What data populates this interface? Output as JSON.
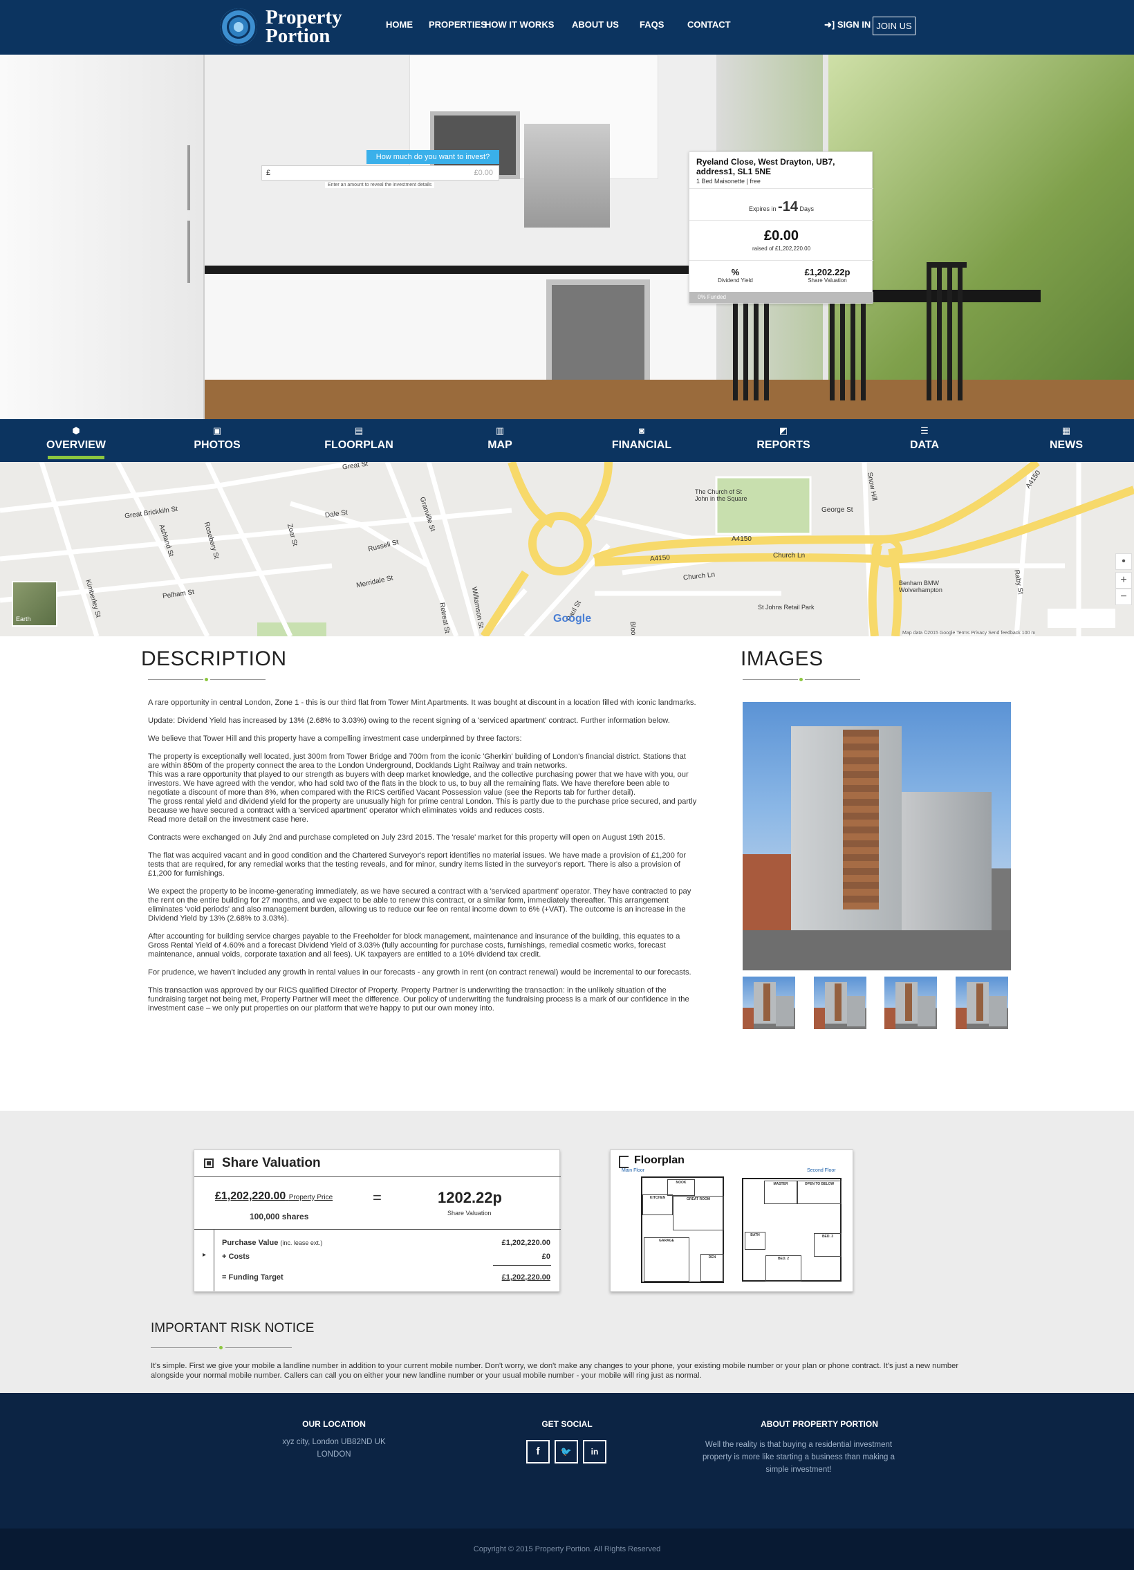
{
  "header": {
    "logo_line1": "Property",
    "logo_line2": "Portion",
    "nav": [
      "HOME",
      "PROPERTIES",
      "HOW IT WORKS",
      "ABOUT US",
      "FAQS",
      "CONTACT"
    ],
    "signin": "SIGN IN",
    "join": "JOIN US"
  },
  "hero": {
    "invest_prompt": "How much do you want to invest?",
    "currency_symbol": "£",
    "invest_placeholder": "£0.00",
    "invest_hint": "Enter an amount to reveal the investment details",
    "card": {
      "title": "Ryeland Close, West Drayton, UB7, address1, SL1 5NE",
      "subtitle": "1 Bed Maisonette | free",
      "expires_prefix": "Expires in",
      "expires_days": "-14",
      "expires_suffix": "Days",
      "amount": "£0.00",
      "raised": "raised of £1,202,220.00",
      "dividend_value": "%",
      "dividend_label": "Dividend Yield",
      "share_value": "£1,202.22p",
      "share_label": "Share Valuation",
      "funded": "0% Funded",
      "funded_fraction": 0
    }
  },
  "tabs": [
    {
      "label": "OVERVIEW",
      "icon": "cube-icon",
      "glyph": "⬢"
    },
    {
      "label": "PHOTOS",
      "icon": "photos-icon",
      "glyph": "▣"
    },
    {
      "label": "FLOORPLAN",
      "icon": "floorplan-icon",
      "glyph": "▤"
    },
    {
      "label": "MAP",
      "icon": "map-icon",
      "glyph": "▥"
    },
    {
      "label": "FINANCIAL",
      "icon": "money-icon",
      "glyph": "◙"
    },
    {
      "label": "REPORTS",
      "icon": "reports-icon",
      "glyph": "◩"
    },
    {
      "label": "DATA",
      "icon": "database-icon",
      "glyph": "☰"
    },
    {
      "label": "NEWS",
      "icon": "news-icon",
      "glyph": "▦"
    }
  ],
  "active_tab": "OVERVIEW",
  "map": {
    "labels": [
      "Great Brickkiln St",
      "Dale St",
      "Russell St",
      "Merridale St",
      "Pelham St",
      "Ashland St",
      "Rosebery St",
      "Zoar St",
      "Granville St",
      "Williamson St",
      "Retreat St",
      "Paul St",
      "Bloo",
      "Great St",
      "The Church of St John in the Square",
      "George St",
      "A4150",
      "A4150",
      "Church Ln",
      "Church Ln",
      "Snow Hill",
      "Benham BMW Wolverhampton",
      "St Johns Retail Park",
      "Raby St",
      "Kimberley St",
      "A4150"
    ],
    "earth": "Earth",
    "google": "Google",
    "attribution": "Map data ©2015 Google   Terms   Privacy   Send feedback   100 m"
  },
  "description": {
    "title": "DESCRIPTION",
    "paragraphs": [
      "A rare opportunity in central London, Zone 1 - this is our third flat from Tower Mint Apartments. It was bought at discount in a location filled with iconic landmarks.",
      "Update: Dividend Yield has increased by 13% (2.68% to 3.03%) owing to the recent signing of a 'serviced apartment' contract. Further information below.",
      "We believe that Tower Hill and this property have a compelling investment case underpinned by three factors:",
      "The property is exceptionally well located, just 300m from Tower Bridge and 700m from the iconic 'Gherkin' building of London's financial district. Stations that are within 850m of the property connect the area to the London Underground, Docklands Light Railway and train networks.\nThis was a rare opportunity that played to our strength as buyers with deep market knowledge, and the collective purchasing power that we have with you, our investors. We have agreed with the vendor, who had sold two of the flats in the block to us, to buy all the remaining flats. We have therefore been able to negotiate a discount of more than 8%, when compared with the RICS certified Vacant Possession value (see the Reports tab for further detail).\nThe gross rental yield and dividend yield for the property are unusually high for prime central London. This is partly due to the purchase price secured, and partly because we have secured a contract with a 'serviced apartment' operator which eliminates voids and reduces costs.\nRead more detail on the investment case here.",
      "Contracts were exchanged on July 2nd and purchase completed on July 23rd 2015. The 'resale' market for this property will open on August 19th 2015.",
      "The flat was acquired vacant and in good condition and the Chartered Surveyor's report identifies no material issues. We have made a provision of £1,200 for tests that are required, for any remedial works that the testing reveals, and for minor, sundry items listed in the surveyor's report. There is also a provision of £1,200 for furnishings.",
      "We expect the property to be income-generating immediately, as we have secured a contract with a 'serviced apartment' operator. They have contracted to pay the rent on the entire building for 27 months, and we expect to be able to renew this contract, or a similar form, immediately thereafter. This arrangement eliminates 'void periods' and also management burden, allowing us to reduce our fee on rental income down to 6% (+VAT).  The outcome is an increase in the Dividend Yield by 13% (2.68% to 3.03%).",
      "After accounting for building service charges payable to the Freeholder for block management, maintenance and insurance of the building, this equates to a Gross Rental Yield of 4.60% and a forecast Dividend Yield of 3.03% (fully accounting for purchase costs, furnishings, remedial cosmetic works, forecast maintenance, annual voids, corporate taxation and all fees). UK taxpayers are entitled to a 10% dividend tax credit.",
      "For prudence, we haven't included any growth in rental values in our forecasts - any growth in rent (on contract renewal) would be incremental to our forecasts.",
      "This transaction was approved by our RICS qualified Director of Property. Property Partner is underwriting the transaction: in the unlikely situation of the fundraising target not being met, Property Partner will meet the difference. Our policy of underwriting the fundraising process is a mark of our confidence in the investment case – we only put properties on our platform that we're happy to put our own money into."
    ]
  },
  "images": {
    "title": "IMAGES",
    "thumb_count": 4
  },
  "share_valuation": {
    "title": "Share Valuation",
    "property_price": "£1,202,220.00",
    "property_price_label": "Property Price",
    "shares": "100,000 shares",
    "equals": "=",
    "share_value": "1202.22p",
    "share_value_label": "Share Valuation",
    "rows": [
      {
        "label": "Purchase Value",
        "note": "(inc. lease ext.)",
        "value": "£1,202,220.00"
      },
      {
        "label": "+ Costs",
        "value": "£0"
      },
      {
        "label": "= Funding Target",
        "value": "£1,202,220.00"
      }
    ],
    "arrow": "▸"
  },
  "floorplan": {
    "title": "Floorplan",
    "main_floor": "Main Floor",
    "second_floor": "Second Floor",
    "rooms": [
      "NOOK",
      "KITCHEN",
      "GREAT ROOM",
      "GARAGE",
      "DEN",
      "MASTER",
      "OPEN TO BELOW",
      "BATH",
      "BED. 3",
      "BED. 2"
    ]
  },
  "risk": {
    "title": "IMPORTANT RISK NOTICE",
    "text": "It's simple. First we give your mobile a landline number in addition to your current mobile number. Don't worry, we don't make any changes to your phone, your existing mobile number or your plan or phone contract. It's just a new number alongside your normal mobile number. Callers can call you on either your new landline number or your usual mobile number - your mobile will ring just as normal."
  },
  "footer": {
    "location_title": "OUR LOCATION",
    "location_line1": "xyz city, London UB82ND UK",
    "location_line2": "LONDON",
    "social_title": "GET SOCIAL",
    "social": [
      {
        "glyph": "f",
        "icon": "facebook-icon"
      },
      {
        "glyph": "🐦",
        "icon": "twitter-icon"
      },
      {
        "glyph": "in",
        "icon": "linkedin-icon"
      }
    ],
    "about_title": "ABOUT PROPERTY PORTION",
    "about_text": "Well the reality is that buying a residential investment property is more like starting a business than making a simple investment!",
    "copyright": "Copyright © 2015 Property Portion. All Rights Reserved"
  },
  "colors": {
    "navy": "#0c3460",
    "accent_green": "#8cc63f",
    "cyan": "#3ab0ea",
    "footer": "#0c2444"
  }
}
